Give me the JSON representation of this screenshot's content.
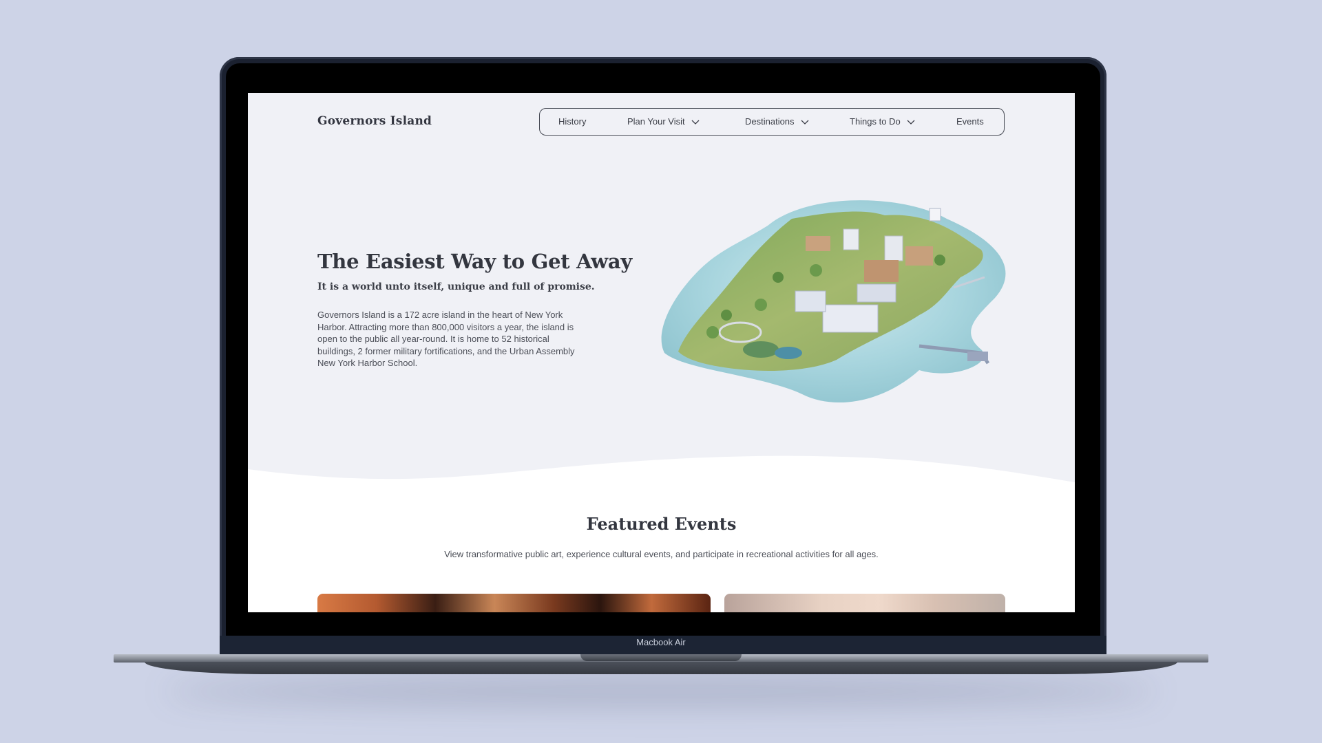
{
  "device": {
    "label": "Macbook Air"
  },
  "site": {
    "logo": "Governors Island",
    "nav": [
      {
        "label": "History",
        "has_dropdown": false
      },
      {
        "label": "Plan Your Visit",
        "has_dropdown": true
      },
      {
        "label": "Destinations",
        "has_dropdown": true
      },
      {
        "label": "Things to Do",
        "has_dropdown": true
      },
      {
        "label": "Events",
        "has_dropdown": false
      }
    ]
  },
  "hero": {
    "title": "The Easiest Way to Get Away",
    "subtitle": "It is a world unto itself, unique and full of promise.",
    "body": "Governors Island is a 172 acre island in the heart of New York Harbor. Attracting more than 800,000 visitors a year, the island is open to the public all year-round. It is home to 52 historical buildings, 2 former military fortifications, and the Urban Assembly New York Harbor School."
  },
  "featured": {
    "title": "Featured Events",
    "description": "View transformative public art, experience cultural events, and participate in recreational activities for all ages."
  },
  "colors": {
    "page_background": "#cdd3e7",
    "site_background": "#f0f1f6",
    "text_dark": "#33363f",
    "water": "#a9d6df"
  }
}
